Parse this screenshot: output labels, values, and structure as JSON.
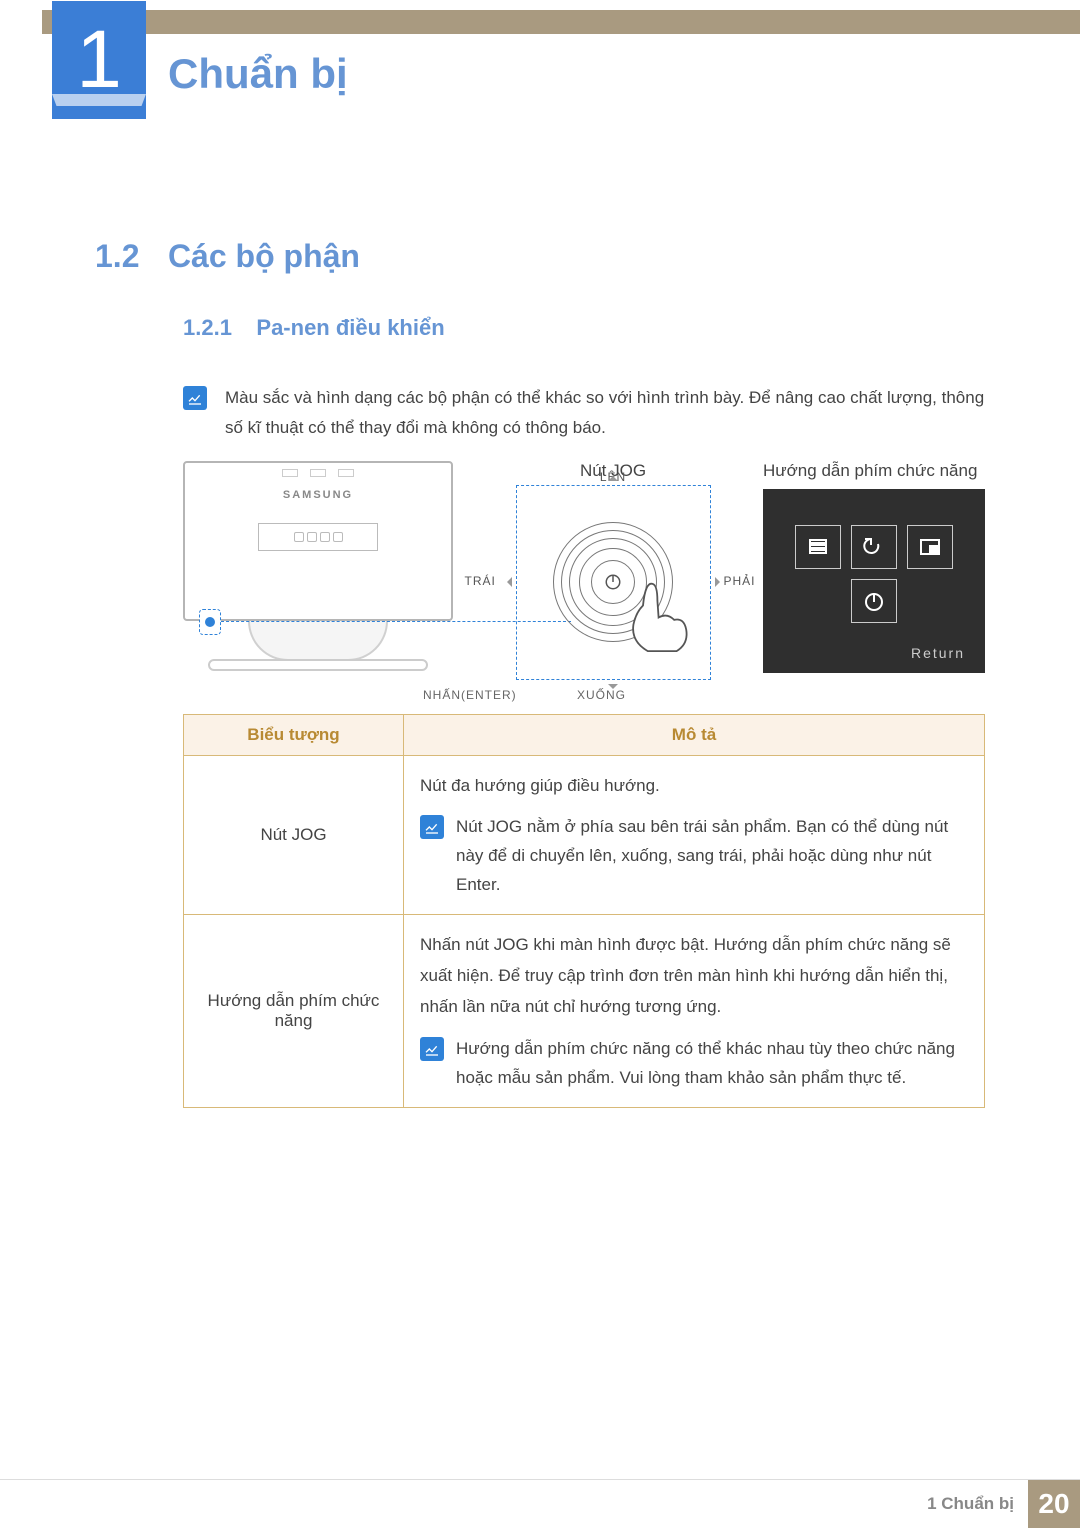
{
  "chapter": {
    "number": "1",
    "title": "Chuẩn bị"
  },
  "section": {
    "number": "1.2",
    "title": "Các bộ phận"
  },
  "subsection": {
    "number": "1.2.1",
    "title": "Pa-nen điều khiển"
  },
  "intro_note": "Màu sắc và hình dạng các bộ phận có thể khác so với hình trình bày. Để nâng cao chất lượng, thông số kĩ thuật có thể thay đổi mà không có thông báo.",
  "diagram": {
    "monitor_brand": "SAMSUNG",
    "jog_label": "Nút JOG",
    "dir_up": "LÊN",
    "dir_down": "XUỐNG",
    "dir_left": "TRÁI",
    "dir_right": "PHẢI",
    "press_enter": "NHẤN(ENTER)",
    "guide_title": "Hướng dẫn phím chức năng",
    "return_label": "Return"
  },
  "table": {
    "head_icon": "Biểu tượng",
    "head_desc": "Mô tả",
    "rows": [
      {
        "icon": "Nút JOG",
        "desc_main": "Nút đa hướng giúp điều hướng.",
        "note": "Nút JOG nằm ở phía sau bên trái sản phẩm. Bạn có thể dùng nút này để di chuyển lên, xuống, sang trái, phải hoặc dùng như nút Enter."
      },
      {
        "icon": "Hướng dẫn phím chức năng",
        "desc_main": "Nhấn nút JOG khi màn hình được bật. Hướng dẫn phím chức năng sẽ xuất hiện. Để truy cập trình đơn trên màn hình khi hướng dẫn hiển thị, nhấn lần nữa nút chỉ hướng tương ứng.",
        "note": "Hướng dẫn phím chức năng có thể khác nhau tùy theo chức năng hoặc mẫu sản phẩm. Vui lòng tham khảo sản phẩm thực tế."
      }
    ]
  },
  "footer": {
    "label": "1 Chuẩn bị",
    "page": "20"
  }
}
